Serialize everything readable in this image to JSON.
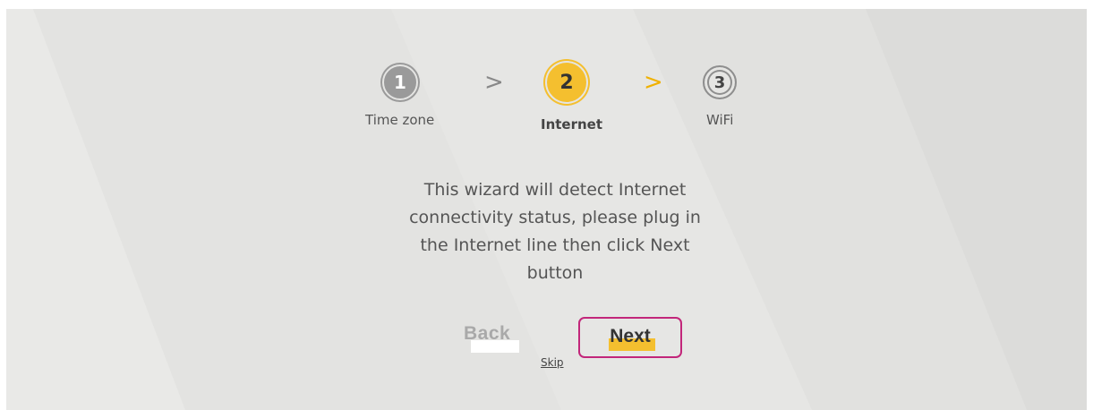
{
  "wizard": {
    "steps": [
      {
        "number": "1",
        "label": "Time zone"
      },
      {
        "number": "2",
        "label": "Internet"
      },
      {
        "number": "3",
        "label": "WiFi"
      }
    ],
    "separators": [
      ">",
      ">"
    ],
    "message": "This wizard will detect Internet\nconnectivity status, please plug in\nthe Internet line then click Next\nbutton",
    "buttons": {
      "back": "Back",
      "next": "Next"
    },
    "skip": "Skip"
  },
  "colors": {
    "accent": "#f4bf2f",
    "highlight_border": "#c2267a",
    "step_done": "#9a9a9a",
    "background": "#e5e5e3"
  }
}
